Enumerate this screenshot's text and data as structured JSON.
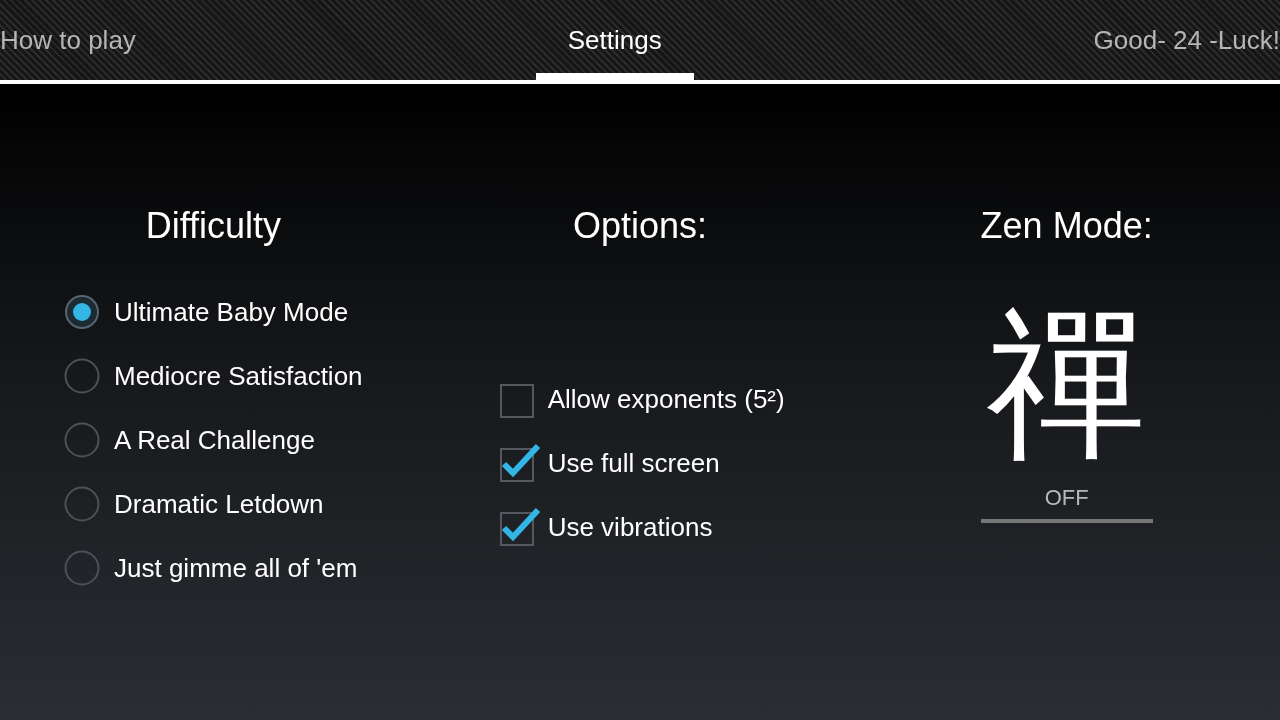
{
  "tabs": [
    {
      "label": "How to play",
      "selected": false
    },
    {
      "label": "Settings",
      "selected": true
    },
    {
      "label": "Good- 24 -Luck!",
      "selected": false
    }
  ],
  "difficulty": {
    "title": "Difficulty",
    "options": [
      {
        "label": "Ultimate Baby Mode",
        "selected": true
      },
      {
        "label": "Mediocre Satisfaction",
        "selected": false
      },
      {
        "label": "A Real Challenge",
        "selected": false
      },
      {
        "label": "Dramatic Letdown",
        "selected": false
      },
      {
        "label": "Just gimme all of 'em",
        "selected": false
      }
    ]
  },
  "options": {
    "title": "Options:",
    "items": [
      {
        "label": "Allow exponents (5²)",
        "checked": false
      },
      {
        "label": "Use full screen",
        "checked": true
      },
      {
        "label": "Use vibrations",
        "checked": true
      }
    ]
  },
  "zen_mode": {
    "title": "Zen Mode:",
    "symbol": "禪",
    "toggle": {
      "label": "OFF",
      "on": false
    }
  }
}
